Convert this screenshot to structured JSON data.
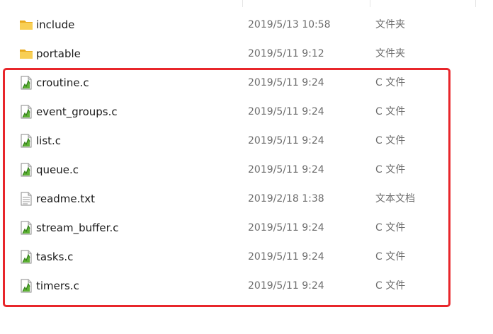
{
  "file_list": {
    "rows": [
      {
        "name": "include",
        "date": "2019/5/13 10:58",
        "type": "文件夹",
        "icon": "folder-icon"
      },
      {
        "name": "portable",
        "date": "2019/5/11 9:12",
        "type": "文件夹",
        "icon": "folder-icon"
      },
      {
        "name": "croutine.c",
        "date": "2019/5/11 9:24",
        "type": "C 文件",
        "icon": "c-source-file-icon"
      },
      {
        "name": "event_groups.c",
        "date": "2019/5/11 9:24",
        "type": "C 文件",
        "icon": "c-source-file-icon"
      },
      {
        "name": "list.c",
        "date": "2019/5/11 9:24",
        "type": "C 文件",
        "icon": "c-source-file-icon"
      },
      {
        "name": "queue.c",
        "date": "2019/5/11 9:24",
        "type": "C 文件",
        "icon": "c-source-file-icon"
      },
      {
        "name": "readme.txt",
        "date": "2019/2/18 1:38",
        "type": "文本文档",
        "icon": "text-file-icon"
      },
      {
        "name": "stream_buffer.c",
        "date": "2019/5/11 9:24",
        "type": "C 文件",
        "icon": "c-source-file-icon"
      },
      {
        "name": "tasks.c",
        "date": "2019/5/11 9:24",
        "type": "C 文件",
        "icon": "c-source-file-icon"
      },
      {
        "name": "timers.c",
        "date": "2019/5/11 9:24",
        "type": "C 文件",
        "icon": "c-source-file-icon"
      }
    ]
  },
  "colors": {
    "highlight_border": "#e8262b",
    "folder": "#f5c243",
    "c_file_accent": "#55a630"
  }
}
